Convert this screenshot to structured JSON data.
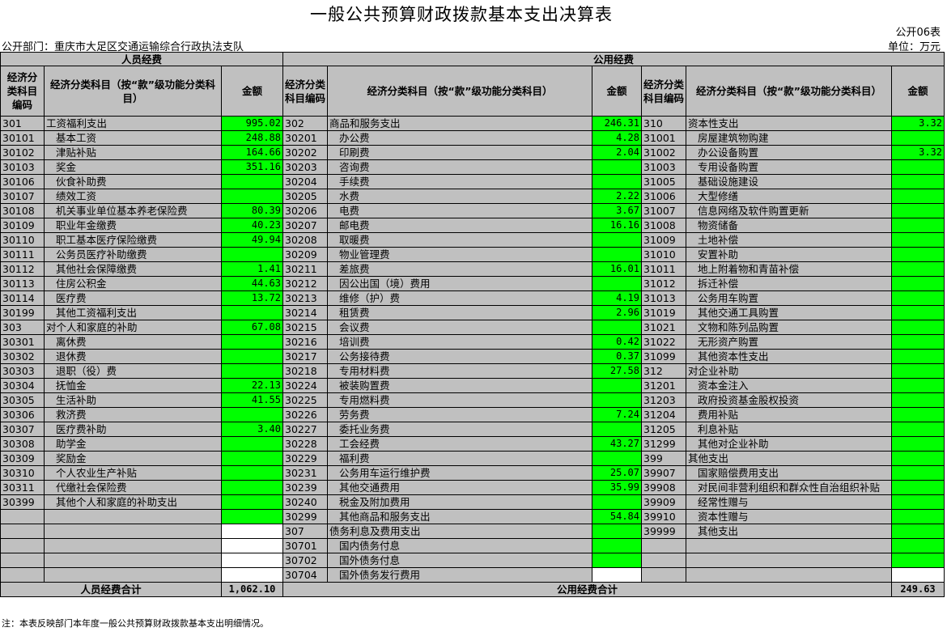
{
  "title": "一般公共预算财政拨款基本支出决算表",
  "table_code": "公开06表",
  "department": "公开部门：重庆市大足区交通运输综合行政执法支队",
  "unit": "单位：万元",
  "section_personnel": "人员经费",
  "section_public": "公用经费",
  "col_code": "经济分类科目编码",
  "col_name": "经济分类科目（按“款”级功能分类科目）",
  "col_amount": "金额",
  "rows": [
    [
      {
        "code": "301",
        "name": "工资福利支出",
        "amount": "995.02"
      },
      {
        "code": "302",
        "name": "商品和服务支出",
        "amount": "246.31"
      },
      {
        "code": "310",
        "name": "资本性支出",
        "amount": "3.32"
      }
    ],
    [
      {
        "code": "30101",
        "name": "基本工资",
        "amount": "248.88"
      },
      {
        "code": "30201",
        "name": "办公费",
        "amount": "4.28"
      },
      {
        "code": "31001",
        "name": "房屋建筑物购建",
        "amount": ""
      }
    ],
    [
      {
        "code": "30102",
        "name": "津贴补贴",
        "amount": "164.66"
      },
      {
        "code": "30202",
        "name": "印刷费",
        "amount": "2.04"
      },
      {
        "code": "31002",
        "name": "办公设备购置",
        "amount": "3.32"
      }
    ],
    [
      {
        "code": "30103",
        "name": "奖金",
        "amount": "351.16"
      },
      {
        "code": "30203",
        "name": "咨询费",
        "amount": ""
      },
      {
        "code": "31003",
        "name": "专用设备购置",
        "amount": ""
      }
    ],
    [
      {
        "code": "30106",
        "name": "伙食补助费",
        "amount": ""
      },
      {
        "code": "30204",
        "name": "手续费",
        "amount": ""
      },
      {
        "code": "31005",
        "name": "基础设施建设",
        "amount": ""
      }
    ],
    [
      {
        "code": "30107",
        "name": "绩效工资",
        "amount": ""
      },
      {
        "code": "30205",
        "name": "水费",
        "amount": "2.22"
      },
      {
        "code": "31006",
        "name": "大型修缮",
        "amount": ""
      }
    ],
    [
      {
        "code": "30108",
        "name": "机关事业单位基本养老保险费",
        "amount": "80.39"
      },
      {
        "code": "30206",
        "name": "电费",
        "amount": "3.67"
      },
      {
        "code": "31007",
        "name": "信息网络及软件购置更新",
        "amount": ""
      }
    ],
    [
      {
        "code": "30109",
        "name": "职业年金缴费",
        "amount": "40.23"
      },
      {
        "code": "30207",
        "name": "邮电费",
        "amount": "16.16"
      },
      {
        "code": "31008",
        "name": "物资储备",
        "amount": ""
      }
    ],
    [
      {
        "code": "30110",
        "name": "职工基本医疗保险缴费",
        "amount": "49.94"
      },
      {
        "code": "30208",
        "name": "取暖费",
        "amount": ""
      },
      {
        "code": "31009",
        "name": "土地补偿",
        "amount": ""
      }
    ],
    [
      {
        "code": "30111",
        "name": "公务员医疗补助缴费",
        "amount": ""
      },
      {
        "code": "30209",
        "name": "物业管理费",
        "amount": ""
      },
      {
        "code": "31010",
        "name": "安置补助",
        "amount": ""
      }
    ],
    [
      {
        "code": "30112",
        "name": "其他社会保障缴费",
        "amount": "1.41"
      },
      {
        "code": "30211",
        "name": "差旅费",
        "amount": "16.01"
      },
      {
        "code": "31011",
        "name": "地上附着物和青苗补偿",
        "amount": ""
      }
    ],
    [
      {
        "code": "30113",
        "name": "住房公积金",
        "amount": "44.63"
      },
      {
        "code": "30212",
        "name": "因公出国（境）费用",
        "amount": ""
      },
      {
        "code": "31012",
        "name": "拆迁补偿",
        "amount": ""
      }
    ],
    [
      {
        "code": "30114",
        "name": "医疗费",
        "amount": "13.72"
      },
      {
        "code": "30213",
        "name": "维修（护）费",
        "amount": "4.19"
      },
      {
        "code": "31013",
        "name": "公务用车购置",
        "amount": ""
      }
    ],
    [
      {
        "code": "30199",
        "name": "其他工资福利支出",
        "amount": ""
      },
      {
        "code": "30214",
        "name": "租赁费",
        "amount": "2.96"
      },
      {
        "code": "31019",
        "name": "其他交通工具购置",
        "amount": ""
      }
    ],
    [
      {
        "code": "303",
        "name": "对个人和家庭的补助",
        "amount": "67.08"
      },
      {
        "code": "30215",
        "name": "会议费",
        "amount": ""
      },
      {
        "code": "31021",
        "name": "文物和陈列品购置",
        "amount": ""
      }
    ],
    [
      {
        "code": "30301",
        "name": "离休费",
        "amount": ""
      },
      {
        "code": "30216",
        "name": "培训费",
        "amount": "0.42"
      },
      {
        "code": "31022",
        "name": "无形资产购置",
        "amount": ""
      }
    ],
    [
      {
        "code": "30302",
        "name": "退休费",
        "amount": ""
      },
      {
        "code": "30217",
        "name": "公务接待费",
        "amount": "0.37"
      },
      {
        "code": "31099",
        "name": "其他资本性支出",
        "amount": ""
      }
    ],
    [
      {
        "code": "30303",
        "name": "退职（役）费",
        "amount": ""
      },
      {
        "code": "30218",
        "name": "专用材料费",
        "amount": "27.58"
      },
      {
        "code": "312",
        "name": "对企业补助",
        "amount": ""
      }
    ],
    [
      {
        "code": "30304",
        "name": "抚恤金",
        "amount": "22.13"
      },
      {
        "code": "30224",
        "name": "被装购置费",
        "amount": ""
      },
      {
        "code": "31201",
        "name": "资本金注入",
        "amount": ""
      }
    ],
    [
      {
        "code": "30305",
        "name": "生活补助",
        "amount": "41.55"
      },
      {
        "code": "30225",
        "name": "专用燃料费",
        "amount": ""
      },
      {
        "code": "31203",
        "name": "政府投资基金股权投资",
        "amount": ""
      }
    ],
    [
      {
        "code": "30306",
        "name": "救济费",
        "amount": ""
      },
      {
        "code": "30226",
        "name": "劳务费",
        "amount": "7.24"
      },
      {
        "code": "31204",
        "name": "费用补贴",
        "amount": ""
      }
    ],
    [
      {
        "code": "30307",
        "name": "医疗费补助",
        "amount": "3.40"
      },
      {
        "code": "30227",
        "name": "委托业务费",
        "amount": ""
      },
      {
        "code": "31205",
        "name": "利息补贴",
        "amount": ""
      }
    ],
    [
      {
        "code": "30308",
        "name": "助学金",
        "amount": ""
      },
      {
        "code": "30228",
        "name": "工会经费",
        "amount": "43.27"
      },
      {
        "code": "31299",
        "name": "其他对企业补助",
        "amount": ""
      }
    ],
    [
      {
        "code": "30309",
        "name": "奖励金",
        "amount": ""
      },
      {
        "code": "30229",
        "name": "福利费",
        "amount": ""
      },
      {
        "code": "399",
        "name": "其他支出",
        "amount": ""
      }
    ],
    [
      {
        "code": "30310",
        "name": "个人农业生产补贴",
        "amount": ""
      },
      {
        "code": "30231",
        "name": "公务用车运行维护费",
        "amount": "25.07"
      },
      {
        "code": "39907",
        "name": "国家赔偿费用支出",
        "amount": ""
      }
    ],
    [
      {
        "code": "30311",
        "name": "代缴社会保险费",
        "amount": ""
      },
      {
        "code": "30239",
        "name": "其他交通费用",
        "amount": "35.99"
      },
      {
        "code": "39908",
        "name": "对民间非营利组织和群众性自治组织补贴",
        "amount": ""
      }
    ],
    [
      {
        "code": "30399",
        "name": "其他个人和家庭的补助支出",
        "amount": ""
      },
      {
        "code": "30240",
        "name": "税金及附加费用",
        "amount": ""
      },
      {
        "code": "39909",
        "name": "经常性赠与",
        "amount": ""
      }
    ],
    [
      {
        "code": "",
        "name": "",
        "amount": ""
      },
      {
        "code": "30299",
        "name": "其他商品和服务支出",
        "amount": "54.84"
      },
      {
        "code": "39910",
        "name": "资本性赠与",
        "amount": ""
      }
    ],
    [
      {
        "code": "",
        "name": "",
        "amount": ""
      },
      {
        "code": "307",
        "name": "债务利息及费用支出",
        "amount": ""
      },
      {
        "code": "39999",
        "name": "其他支出",
        "amount": ""
      }
    ],
    [
      {
        "code": "",
        "name": "",
        "amount": ""
      },
      {
        "code": "30701",
        "name": "国内债务付息",
        "amount": ""
      },
      {
        "code": "",
        "name": "",
        "amount": ""
      }
    ],
    [
      {
        "code": "",
        "name": "",
        "amount": ""
      },
      {
        "code": "30702",
        "name": "国外债务付息",
        "amount": ""
      },
      {
        "code": "",
        "name": "",
        "amount": ""
      }
    ],
    [
      {
        "code": "",
        "name": "",
        "amount": ""
      },
      {
        "code": "30704",
        "name": "国外债务发行费用",
        "amount": ""
      },
      {
        "code": "",
        "name": "",
        "amount": ""
      }
    ]
  ],
  "total_personnel_label": "人员经费合计",
  "total_personnel_value": "1,062.10",
  "total_public_label": "公用经费合计",
  "total_public_value": "249.63",
  "footnote": "注：本表反映部门本年度一般公共预算财政拨款基本支出明细情况。"
}
